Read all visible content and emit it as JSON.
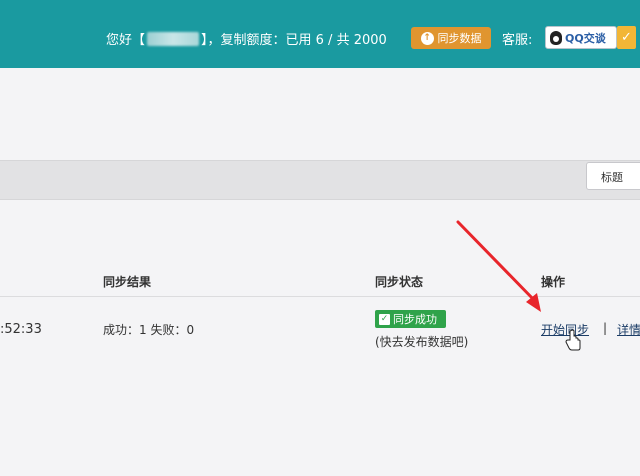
{
  "header": {
    "greeting_prefix": "您好【",
    "greeting_name": "",
    "greeting_suffix": "】，复制额度：已用 6 / 共 2000",
    "sync_button_label": "同步数据",
    "service_label": "客服:",
    "qq_button_label": "QQ交谈",
    "check_icon": "checkmark-icon"
  },
  "filter": {
    "title_select_value": "标题"
  },
  "table": {
    "columns": {
      "result": "同步结果",
      "status": "同步状态",
      "action": "操作"
    },
    "row": {
      "time": ":52:33",
      "result": "成功：1 失败：0",
      "status_badge": "同步成功",
      "status_hint": "(快去发布数据吧)",
      "action_start": "开始同步",
      "action_separator": "|",
      "action_detail": "详情"
    }
  },
  "colors": {
    "header_bg": "#1a9aa0",
    "sync_button": "#e0952f",
    "success": "#2fa34a",
    "arrow": "#e8252b"
  }
}
